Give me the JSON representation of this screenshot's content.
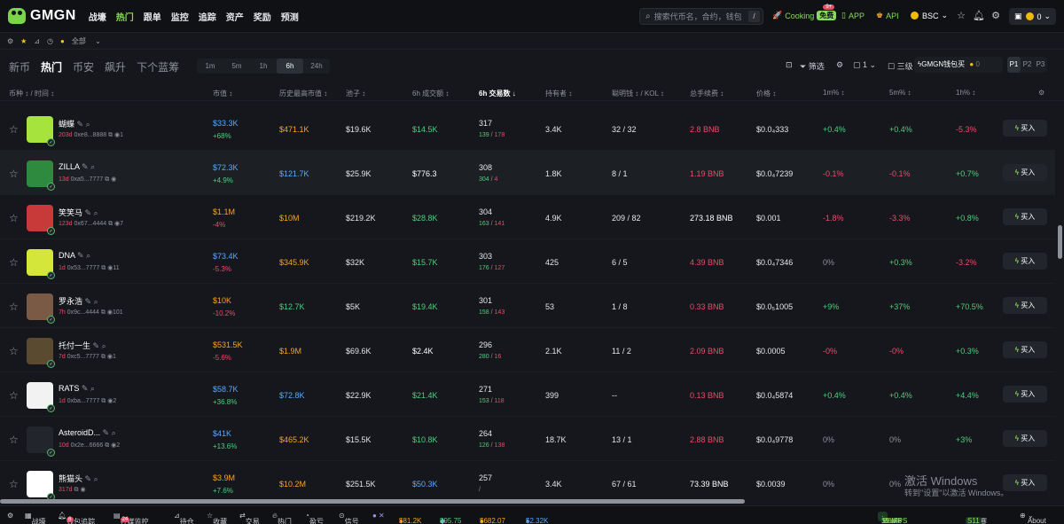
{
  "brand": "GMGN",
  "nav": [
    "战壕",
    "热门",
    "跟单",
    "监控",
    "追踪",
    "资产",
    "奖励",
    "预测"
  ],
  "nav_active": 1,
  "search_placeholder": "搜索代币名，合约，钱包",
  "search_shortcut": "/",
  "cooking": {
    "label": "Cooking",
    "badge": "免费",
    "count": "9+"
  },
  "app_label": "APP",
  "api_label": "API",
  "chain": "BSC",
  "wallet_balance": "0",
  "subbar_all": "全部",
  "main_tabs": [
    "新币",
    "热门",
    "币安",
    "飙升",
    "下个蓝筹"
  ],
  "main_tab_active": 1,
  "time_tabs": [
    "1m",
    "5m",
    "1h",
    "6h",
    "24h"
  ],
  "time_tab_active": 3,
  "filter_label": "筛选",
  "layout_count": "1",
  "hide_label": "三级",
  "gmgn_buy": {
    "label": "GMGN钱包买",
    "value": "0"
  },
  "pages": [
    "P1",
    "P2",
    "P3"
  ],
  "columns": {
    "token": "币种 ↕ / 时间 ↕",
    "mc": "市值 ↕",
    "ath": "历史最高市值 ↕",
    "liq": "池子 ↕",
    "vol": "6h 成交额 ↕",
    "tx": "6h 交易数 ↓",
    "holders": "持有者 ↕",
    "smart": "聪明钱 ↕ / KOL ↕",
    "fee": "总手续费 ↕",
    "price": "价格 ↕",
    "m1": "1m% ↕",
    "m5": "5m% ↕",
    "h1": "1h% ↕"
  },
  "buy_label": "买入",
  "tokens": [
    {
      "name": "蝴蝶",
      "age": "203d",
      "addr": "0xe8...8888",
      "extra": "1",
      "mc": "$33.3K",
      "mc_change": "+68%",
      "ath": "$471.1K",
      "liq": "$19.6K",
      "vol": "$14.5K",
      "tx": "317",
      "buys": "139",
      "sells": "178",
      "holders": "3.4K",
      "smart": "32 / 32",
      "fee": "2.8 BNB",
      "price": "$0.0₄333",
      "m1": "+0.4%",
      "m5": "+0.4%",
      "h1": "-5.3%",
      "avatar_color": "#a7e33d"
    },
    {
      "name": "ZILLA",
      "age": "13d",
      "addr": "0xa5...7777",
      "extra": "",
      "mc": "$72.3K",
      "mc_change": "+4.9%",
      "ath": "$121.7K",
      "liq": "$25.9K",
      "vol": "$776.3",
      "tx": "308",
      "buys": "304",
      "sells": "4",
      "holders": "1.8K",
      "smart": "8 / 1",
      "fee": "1.19 BNB",
      "price": "$0.0₄7239",
      "m1": "-0.1%",
      "m5": "-0.1%",
      "h1": "+0.7%",
      "avatar_color": "#2d8a3e"
    },
    {
      "name": "笑笑马",
      "age": "123d",
      "addr": "0x67...4444",
      "extra": "7",
      "mc": "$1.1M",
      "mc_change": "-4%",
      "ath": "$10M",
      "liq": "$219.2K",
      "vol": "$28.8K",
      "tx": "304",
      "buys": "163",
      "sells": "141",
      "holders": "4.9K",
      "smart": "209 / 82",
      "fee": "273.18 BNB",
      "price": "$0.001",
      "m1": "-1.8%",
      "m5": "-3.3%",
      "h1": "+0.8%",
      "avatar_color": "#c83a3a"
    },
    {
      "name": "DNA",
      "age": "1d",
      "addr": "0x53...7777",
      "extra": "11",
      "mc": "$73.4K",
      "mc_change": "-5.3%",
      "ath": "$345.9K",
      "liq": "$32K",
      "vol": "$15.7K",
      "tx": "303",
      "buys": "176",
      "sells": "127",
      "holders": "425",
      "smart": "6 / 5",
      "fee": "4.39 BNB",
      "price": "$0.0₄7346",
      "m1": "0%",
      "m5": "+0.3%",
      "h1": "-3.2%",
      "avatar_color": "#d4e63a"
    },
    {
      "name": "罗永浩",
      "age": "7h",
      "addr": "0x9c...4444",
      "extra": "101",
      "mc": "$10K",
      "mc_change": "-10.2%",
      "ath": "$12.7K",
      "liq": "$5K",
      "vol": "$19.4K",
      "tx": "301",
      "buys": "158",
      "sells": "143",
      "holders": "53",
      "smart": "1 / 8",
      "fee": "0.33 BNB",
      "price": "$0.0₅1005",
      "m1": "+9%",
      "m5": "+37%",
      "h1": "+70.5%",
      "avatar_color": "#7a5a44"
    },
    {
      "name": "托付一生",
      "age": "7d",
      "addr": "0xc5...7777",
      "extra": "1",
      "mc": "$531.5K",
      "mc_change": "-5.6%",
      "ath": "$1.9M",
      "liq": "$69.6K",
      "vol": "$2.4K",
      "tx": "296",
      "buys": "280",
      "sells": "16",
      "holders": "2.1K",
      "smart": "11 / 2",
      "fee": "2.09 BNB",
      "price": "$0.0005",
      "m1": "-0%",
      "m5": "-0%",
      "h1": "+0.3%",
      "avatar_color": "#5a4a30"
    },
    {
      "name": "RATS",
      "age": "1d",
      "addr": "0xba...7777",
      "extra": "2",
      "mc": "$58.7K",
      "mc_change": "+36.8%",
      "ath": "$72.8K",
      "liq": "$22.9K",
      "vol": "$21.4K",
      "tx": "271",
      "buys": "153",
      "sells": "118",
      "holders": "399",
      "smart": "--",
      "fee": "0.13 BNB",
      "price": "$0.0₄5874",
      "m1": "+0.4%",
      "m5": "+0.4%",
      "h1": "+4.4%",
      "avatar_color": "#f2f2f2"
    },
    {
      "name": "AsteroidD...",
      "age": "10d",
      "addr": "0x2e...6666",
      "extra": "2",
      "mc": "$41K",
      "mc_change": "+13.6%",
      "ath": "$465.2K",
      "liq": "$15.5K",
      "vol": "$10.8K",
      "tx": "264",
      "buys": "126",
      "sells": "138",
      "holders": "18.7K",
      "smart": "13 / 1",
      "fee": "2.88 BNB",
      "price": "$0.0₄9778",
      "m1": "0%",
      "m5": "0%",
      "h1": "+3%",
      "avatar_color": "#22252b"
    },
    {
      "name": "熊猫头",
      "age": "317d",
      "addr": "",
      "extra": "",
      "mc": "$3.9M",
      "mc_change": "+7.6%",
      "ath": "$10.2M",
      "liq": "$251.5K",
      "vol": "$50.3K",
      "tx": "257",
      "buys": "",
      "sells": "",
      "holders": "3.4K",
      "smart": "67 / 61",
      "fee": "73.39 BNB",
      "price": "$0.0039",
      "m1": "0%",
      "m5": "0%",
      "h1": "",
      "avatar_color": "#ffffff"
    }
  ],
  "bottom": {
    "items": [
      "战壕",
      "钱包追踪",
      "社媒监控",
      "待仓",
      "收藏",
      "交易",
      "热门",
      "盈亏",
      "信号"
    ],
    "wallet_track_count": "6",
    "social_count": "24",
    "price_btc": "$81.2K",
    "price_eth": "$95.75",
    "price_bnb": "$682.07",
    "price_sol": "$2.32K",
    "status": "Stable",
    "ms": "19 MS",
    "fps": "60 FPS",
    "contest": "交易赛",
    "contest_badge": "S11",
    "about": "About"
  },
  "watermark": {
    "title": "激活 Windows",
    "sub": "转到\"设置\"以激活 Windows。"
  }
}
